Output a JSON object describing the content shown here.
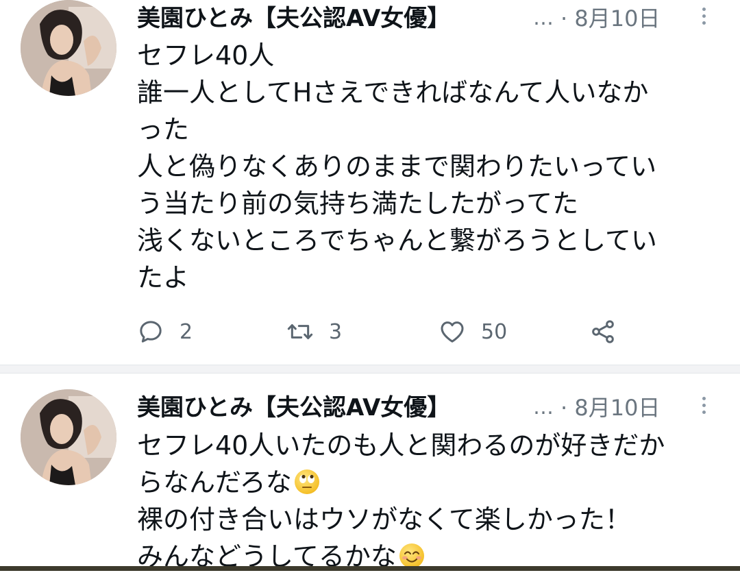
{
  "tweets": [
    {
      "author": "美園ひとみ【夫公認AV女優】",
      "ellipsis": "…",
      "date": "· 8月10日",
      "lines": [
        "セフレ40人",
        "誰一人としてHさえできればなんて人いなか",
        "った",
        "人と偽りなくありのままで関わりたいってい",
        "う当たり前の気持ち満たしたがってた",
        "浅くないところでちゃんと繋がろうとしてい",
        "たよ"
      ],
      "replies": "2",
      "retweets": "3",
      "likes": "50"
    },
    {
      "author": "美園ひとみ【夫公認AV女優】",
      "ellipsis": "…",
      "date": "· 8月10日",
      "lines": [
        "セフレ40人いたのも人と関わるのが好きだか",
        "らなんだろな",
        "裸の付き合いはウソがなくて楽しかった！",
        "みんなどうしてるかな"
      ],
      "emoji_line2": "face-with-rolling-eyes-emoji",
      "emoji_line4": "smiling-face-emoji"
    }
  ],
  "colors": {
    "text": "#0f1419",
    "secondary": "#6b7680",
    "icon": "#5b6670"
  },
  "icons": [
    "reply-icon",
    "retweet-icon",
    "like-icon",
    "share-icon",
    "more-icon"
  ]
}
